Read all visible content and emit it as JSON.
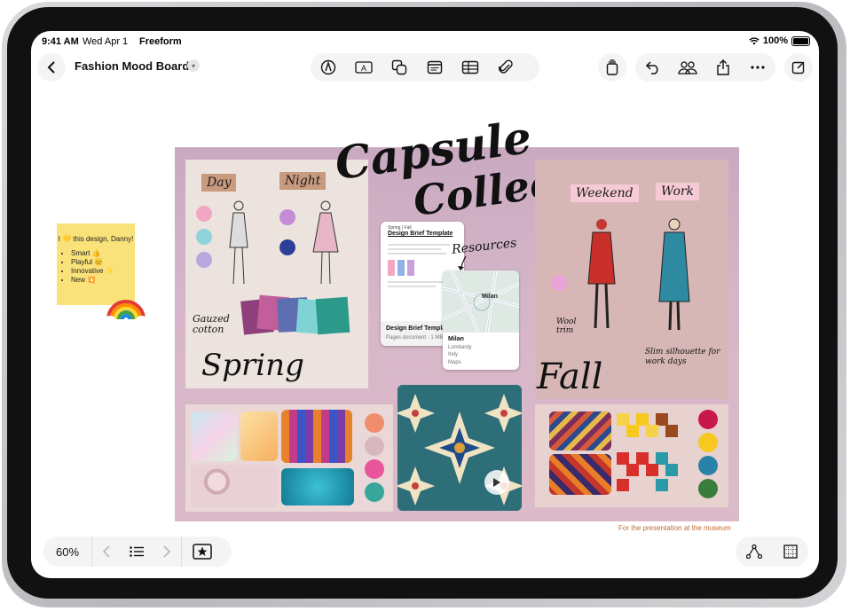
{
  "status_bar": {
    "time": "9:41 AM",
    "date": "Wed Apr 1",
    "app_name": "Freeform",
    "battery": "100%"
  },
  "header": {
    "board_title": "Fashion Mood Board"
  },
  "toolbar": {
    "tools": [
      "pen-icon",
      "text-box-icon",
      "shapes-icon",
      "sticky-note-icon",
      "table-icon",
      "attachment-icon"
    ],
    "right_tools": [
      "stack-icon",
      "undo-icon",
      "collaborate-icon",
      "share-icon",
      "more-icon",
      "new-board-icon"
    ]
  },
  "sticky_note": {
    "greeting": "I 💛 this design, Danny!",
    "items": [
      "Smart 👍",
      "Playful 😊",
      "Innovative ✨",
      "New 💥"
    ]
  },
  "board": {
    "heading_line1": "Capsule",
    "heading_line2": "Collection",
    "spring": {
      "tag_day": "Day",
      "tag_night": "Night",
      "note": "Gauzed cotton",
      "label": "Spring"
    },
    "fall": {
      "tag_weekend": "Weekend",
      "tag_work": "Work",
      "note_left": "Wool trim",
      "note_right": "Slim silhouette for work days",
      "label": "Fall"
    },
    "resources_label": "Resources",
    "doc_card": {
      "kicker": "Spring | Fall",
      "title": "Design Brief Template",
      "footer_title": "Design Brief Template",
      "footer_meta": "Pages document · 1 MB"
    },
    "map_card": {
      "city_label": "Milan",
      "title": "Milan",
      "region": "Lombardy",
      "country": "Italy",
      "source": "Maps"
    }
  },
  "caption": "For the presentation at the museum",
  "bottom_bar": {
    "zoom": "60%"
  },
  "colors": {
    "spring_swatches": [
      "#f1a7c4",
      "#8fd3dc",
      "#b8a6df",
      "#c58bd6",
      "#2b3f9a"
    ],
    "spring_palette": [
      "#f08d6c",
      "#d8b6bd",
      "#e9559d",
      "#36a79a"
    ],
    "fall_palette": [
      "#c8174a",
      "#f7c81e",
      "#2a82a8",
      "#3a7c3c"
    ]
  }
}
